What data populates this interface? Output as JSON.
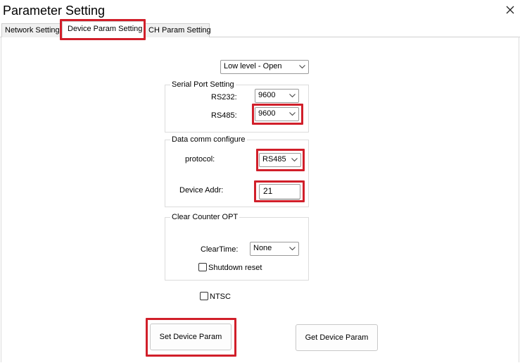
{
  "window": {
    "title": "Parameter Setting"
  },
  "tabs": [
    {
      "label": "Network Setting"
    },
    {
      "label": "Device Param Setting"
    },
    {
      "label": "CH Param Setting"
    }
  ],
  "level_select": {
    "value": "Low level - Open"
  },
  "serial_port": {
    "legend": "Serial Port Setting",
    "rs232_label": "RS232:",
    "rs232_value": "9600",
    "rs485_label": "RS485:",
    "rs485_value": "9600"
  },
  "data_comm": {
    "legend": "Data comm configure",
    "protocol_label": "protocol:",
    "protocol_value": "RS485",
    "addr_label": "Device Addr:",
    "addr_value": "21"
  },
  "clear_counter": {
    "legend": "Clear Counter OPT",
    "cleartime_label": "ClearTime:",
    "cleartime_value": "None",
    "shutdown_label": "Shutdown reset"
  },
  "ntsc_label": "NTSC",
  "buttons": {
    "set": "Set Device Param",
    "get": "Get Device Param"
  }
}
